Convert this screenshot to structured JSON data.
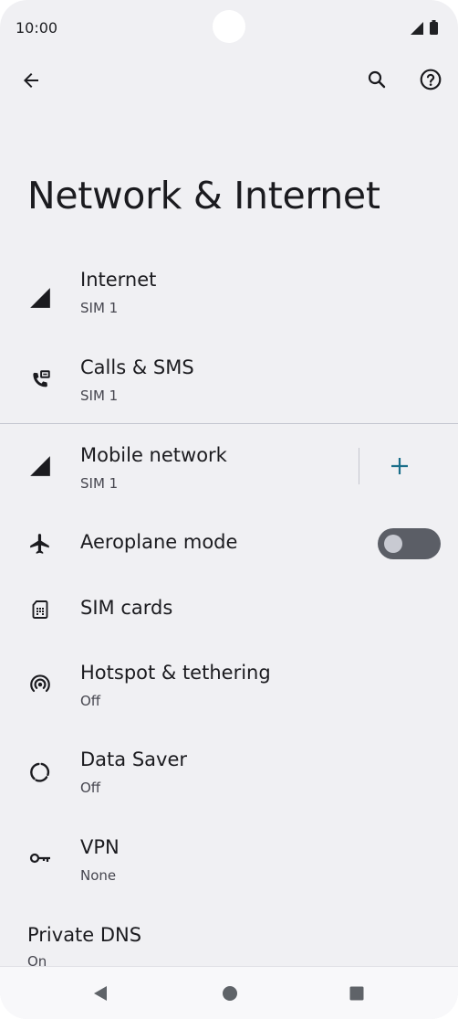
{
  "status_bar": {
    "time": "10:00",
    "signal_icon": "signal-icon",
    "battery_icon": "battery-icon"
  },
  "top_bar": {
    "back_icon": "arrow-back-icon",
    "search_icon": "search-icon",
    "help_icon": "help-icon"
  },
  "page": {
    "title": "Network & Internet"
  },
  "items": [
    {
      "title": "Internet",
      "subtitle": "SIM 1",
      "icon": "signal-icon"
    },
    {
      "title": "Calls & SMS",
      "subtitle": "SIM 1",
      "icon": "phone-sms-icon"
    },
    {
      "title": "Mobile network",
      "subtitle": "SIM 1",
      "icon": "signal-icon",
      "action_icon": "add-icon"
    },
    {
      "title": "Aeroplane mode",
      "icon": "airplane-icon",
      "toggle_on": false
    },
    {
      "title": "SIM cards",
      "icon": "sim-card-icon"
    },
    {
      "title": "Hotspot & tethering",
      "subtitle": "Off",
      "icon": "hotspot-icon"
    },
    {
      "title": "Data Saver",
      "subtitle": "Off",
      "icon": "data-saver-icon"
    },
    {
      "title": "VPN",
      "subtitle": "None",
      "icon": "vpn-key-icon"
    }
  ],
  "private_dns": {
    "title": "Private DNS",
    "subtitle": "On"
  },
  "nav_bar": {
    "back_icon": "nav-back-icon",
    "home_icon": "nav-home-icon",
    "recents_icon": "nav-recents-icon"
  },
  "colors": {
    "background": "#f0f0f3",
    "accent": "#1a6e8a",
    "toggle_track": "#5b5e66"
  }
}
